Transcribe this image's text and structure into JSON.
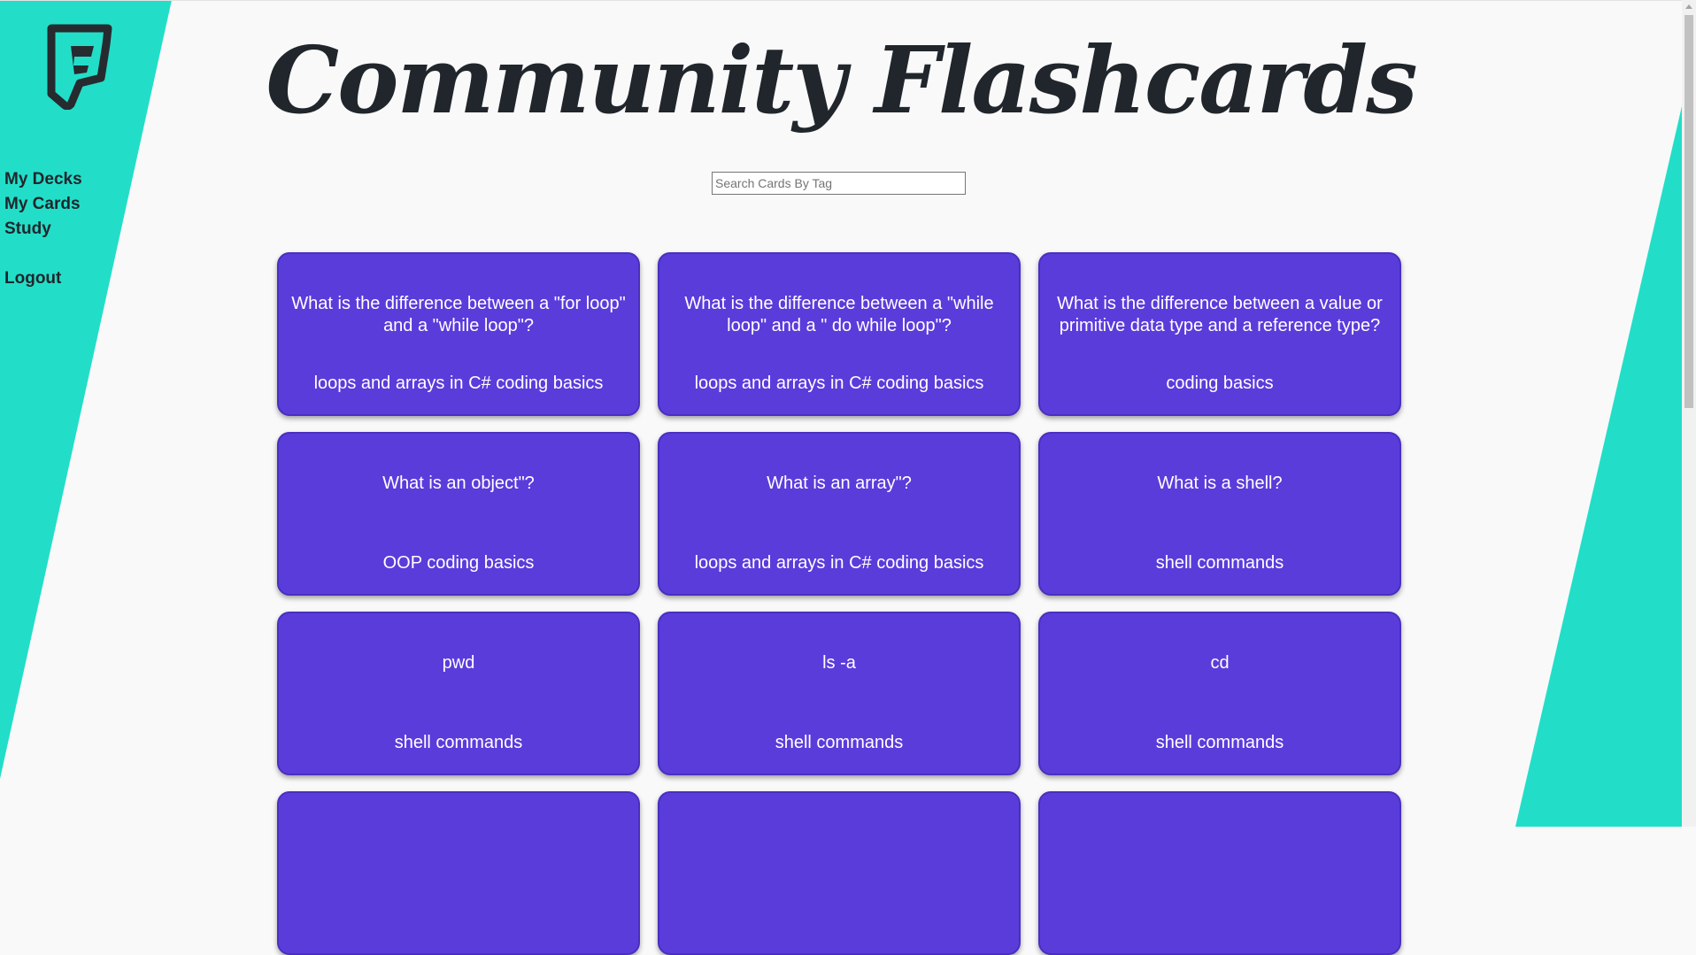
{
  "app": {
    "title": "Community Flashcards",
    "colors": {
      "accent": "#22dec8",
      "card": "#5a3cdb",
      "text_dark": "#21262c"
    }
  },
  "sidebar": {
    "logo_icon": "foursquare-style-f-logo",
    "items": [
      {
        "label": "My Decks"
      },
      {
        "label": "My Cards"
      },
      {
        "label": "Study"
      },
      {
        "label": "Logout"
      }
    ]
  },
  "search": {
    "placeholder": "Search Cards By Tag",
    "value": ""
  },
  "cards": [
    {
      "question": "What is the difference between a \"for loop\" and a \"while loop\"?",
      "tags": "loops and arrays in C# coding basics"
    },
    {
      "question": "What is the difference between a \"while loop\" and a \" do while loop\"?",
      "tags": "loops and arrays in C# coding basics"
    },
    {
      "question": "What is the difference between a value or primitive data type and a reference type?",
      "tags": "coding basics"
    },
    {
      "question": "What is an object\"?",
      "tags": "OOP coding basics"
    },
    {
      "question": "What is an array\"?",
      "tags": "loops and arrays in C# coding basics"
    },
    {
      "question": "What is a shell?",
      "tags": "shell commands"
    },
    {
      "question": "pwd",
      "tags": "shell commands"
    },
    {
      "question": "ls -a",
      "tags": "shell commands"
    },
    {
      "question": "cd",
      "tags": "shell commands"
    },
    {
      "question": "",
      "tags": ""
    },
    {
      "question": "",
      "tags": ""
    },
    {
      "question": "",
      "tags": ""
    }
  ]
}
